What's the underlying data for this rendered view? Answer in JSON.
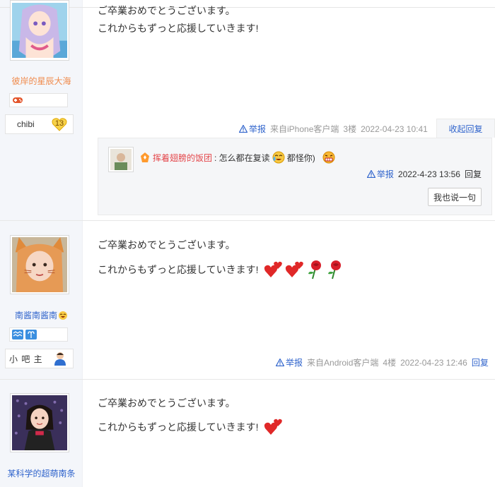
{
  "posts": [
    {
      "username": "彼岸的星辰大海",
      "username_color": "#f08a4b",
      "level_title": "chibi",
      "level_number": "13",
      "line1": "ご卒業おめでとうございます。",
      "line2": "これからもずっと応援していきます!",
      "meta": {
        "report": "举报",
        "device": "来自iPhone客户端",
        "floor": "3楼",
        "time": "2022-04-23 10:41"
      },
      "collapse_label": "收起回复",
      "subreply": {
        "user": "挥着翅膀的饭团",
        "text_before": ": 怎么都在复读",
        "text_after": "都怪你)",
        "report": "举报",
        "time": "2022-4-23 13:56",
        "reply": "回复",
        "button": "我也说一句"
      }
    },
    {
      "username": "南酱南酱南",
      "username_color": "#3064cc",
      "level_title": "小 吧 主",
      "line1": "ご卒業おめでとうございます。",
      "line2": "これからもずっと応援していきます!",
      "meta": {
        "report": "举报",
        "device": "来自Android客户端",
        "floor": "4楼",
        "time": "2022-04-23 12:46",
        "reply": "回复"
      }
    },
    {
      "username": "某科学的超萌南条",
      "username_color": "#3064cc",
      "line1": "ご卒業おめでとうございます。",
      "line2": "これからもずっと応援していきます!"
    }
  ]
}
